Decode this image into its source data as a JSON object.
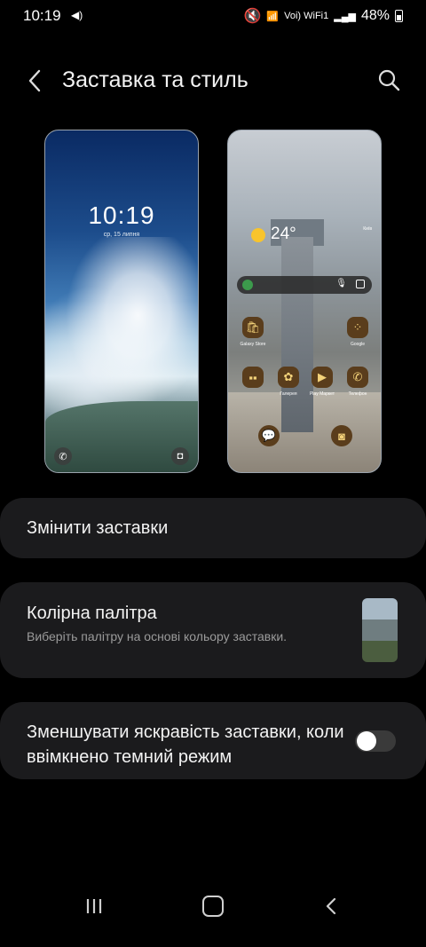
{
  "status_bar": {
    "time": "10:19",
    "right_text": "Voi) WiFi1",
    "battery": "48%"
  },
  "header": {
    "title": "Заставка та стиль"
  },
  "lock_preview": {
    "time": "10:19",
    "date": "ср, 15 липня"
  },
  "home_preview": {
    "temperature": "24°",
    "date_line": "Київ",
    "apps": [
      {
        "label": "Galaxy Store"
      },
      {
        "label": "Google"
      },
      {
        "label": "Галерея"
      },
      {
        "label": "Play Маркет"
      },
      {
        "label": "Телефон"
      }
    ]
  },
  "cards": {
    "change_wallpapers": "Змінити заставки",
    "color_palette_title": "Колірна палітра",
    "color_palette_sub": "Виберіть палітру на основі кольору заставки.",
    "palette_colors": [
      "#a8b9c6",
      "#6f7d80",
      "#4b5d3f"
    ],
    "dim_title": "Зменшувати яскравість заставки, коли ввімкнено темний режим",
    "dim_enabled": false
  }
}
